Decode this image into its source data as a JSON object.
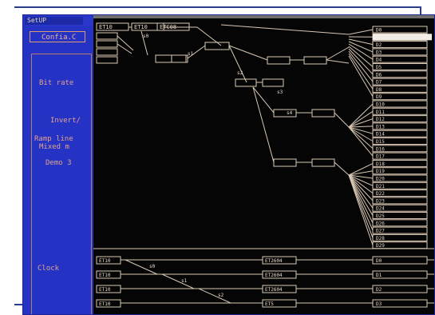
{
  "window": {
    "title": "SetUP"
  },
  "left_panel": {
    "config_button": "Confia.C",
    "labels": {
      "bit_rate": "Bit rate",
      "invert": "Invert/",
      "ramp_line": "Ramp line",
      "mixed": "Mixed m",
      "demo": "Demo 3",
      "clock": "Clock"
    }
  },
  "diagram": {
    "top_labels": [
      "ET10",
      "ET10",
      "ETC08"
    ],
    "output_labels": [
      "D0",
      "D1",
      "D2",
      "D3",
      "D4",
      "D5",
      "D6",
      "D7",
      "D8",
      "D9",
      "D10",
      "D11",
      "D12",
      "D13",
      "D14",
      "D15",
      "D16",
      "D17",
      "D18",
      "D19",
      "D20",
      "D21",
      "D22",
      "D23",
      "D24",
      "D25",
      "D26",
      "D27",
      "D28",
      "D29"
    ],
    "bottom_rows": [
      {
        "left": "ET10",
        "mid": "ET2604",
        "right": "D0"
      },
      {
        "left": "ET10",
        "mid": "ET2604",
        "right": "D1"
      },
      {
        "left": "ET10",
        "mid": "ET2604",
        "right": "D2"
      },
      {
        "left": "ET10",
        "mid": "ET5",
        "right": "D3"
      }
    ],
    "wire_labels": [
      "s0",
      "s1",
      "s2",
      "s3",
      "s4"
    ]
  }
}
